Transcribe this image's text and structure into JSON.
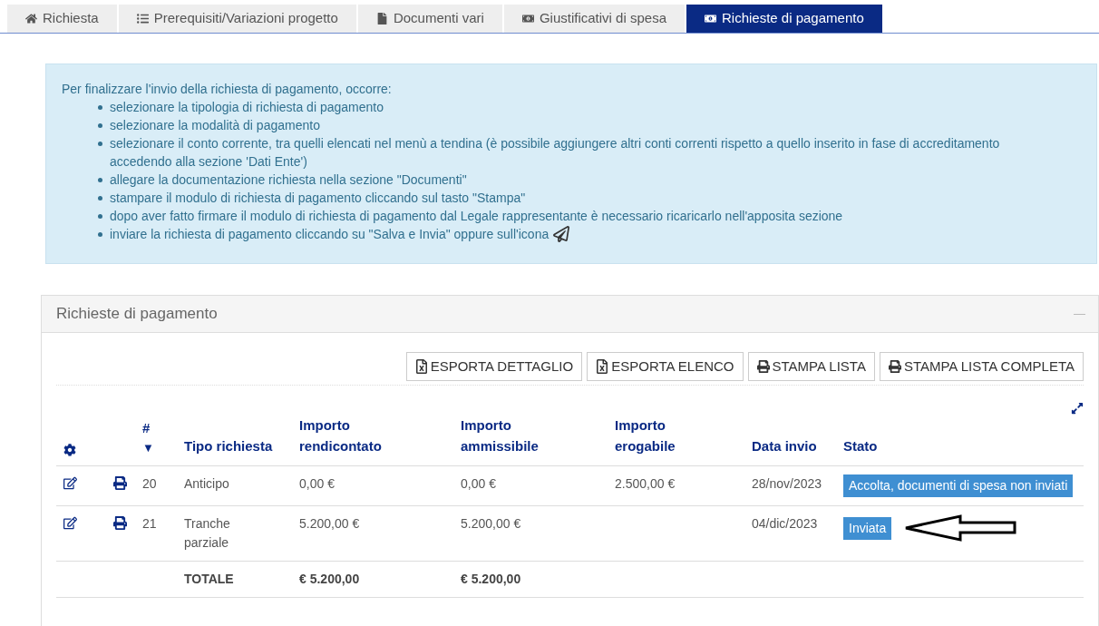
{
  "tabs": [
    {
      "label": "Richiesta",
      "kind": "home",
      "selected": false
    },
    {
      "label": "Prerequisiti/Variazioni progetto",
      "kind": "list",
      "selected": false
    },
    {
      "label": "Documenti vari",
      "kind": "file",
      "selected": false
    },
    {
      "label": "Giustificativi di spesa",
      "kind": "money",
      "selected": false
    },
    {
      "label": "Richieste di pagamento",
      "kind": "money",
      "selected": true
    }
  ],
  "info": {
    "intro": "Per finalizzare l'invio della richiesta di pagamento, occorre:",
    "items": [
      {
        "text": "selezionare la tipologia di richiesta di pagamento",
        "kind": "plain"
      },
      {
        "text": "selezionare la modalità di pagamento",
        "kind": "plain"
      },
      {
        "text": "selezionare il conto corrente, tra quelli elencati nel menù a tendina (è possibile aggiungere altri conti correnti rispetto a quello inserito in fase di accreditamento accedendo alla sezione 'Dati Ente')",
        "kind": "plain"
      },
      {
        "text": "allegare la documentazione richiesta nella sezione \"Documenti\"",
        "kind": "plain"
      },
      {
        "text": "stampare il modulo di richiesta di pagamento cliccando sul tasto \"Stampa\"",
        "kind": "plain"
      },
      {
        "text": "dopo aver fatto firmare il modulo di richiesta di pagamento dal Legale rappresentante è necessario ricaricarlo nell'apposita sezione",
        "kind": "plain"
      },
      {
        "text": "inviare la richiesta di pagamento cliccando su \"Salva e Invia\" oppure sull'icona",
        "kind": "send"
      }
    ]
  },
  "panel": {
    "title": "Richieste di pagamento",
    "buttons": [
      {
        "label": "ESPORTA DETTAGLIO",
        "kind": "excel"
      },
      {
        "label": "ESPORTA ELENCO",
        "kind": "excel"
      },
      {
        "label": "STAMPA LISTA",
        "kind": "print"
      },
      {
        "label": "STAMPA LISTA COMPLETA",
        "kind": "print"
      }
    ],
    "table": {
      "columns": [
        {
          "kind": "settings"
        },
        {
          "kind": "blank"
        },
        {
          "kind": "sort",
          "label": "#",
          "sort_indicator": "▼"
        },
        {
          "kind": "text",
          "label": "Tipo richiesta"
        },
        {
          "kind": "text",
          "label": "Importo rendicontato"
        },
        {
          "kind": "text",
          "label": "Importo ammissibile"
        },
        {
          "kind": "text",
          "label": "Importo erogabile"
        },
        {
          "kind": "text",
          "label": "Data invio"
        },
        {
          "kind": "text",
          "label": "Stato"
        }
      ],
      "rows": [
        {
          "number": "20",
          "tipo": "Anticipo",
          "rendicontato": "0,00 €",
          "ammissibile": "0,00 €",
          "erogabile": "2.500,00 €",
          "data_invio": "28/nov/2023",
          "stato": "Accolta, documenti di spesa non inviati"
        },
        {
          "number": "21",
          "tipo": "Tranche parziale",
          "rendicontato": "5.200,00 €",
          "ammissibile": "5.200,00 €",
          "erogabile": "",
          "data_invio": "04/dic/2023",
          "stato": "Inviata"
        }
      ],
      "totals": {
        "label": "TOTALE",
        "rendicontato": "€ 5.200,00",
        "ammissibile": "€ 5.200,00"
      }
    }
  }
}
